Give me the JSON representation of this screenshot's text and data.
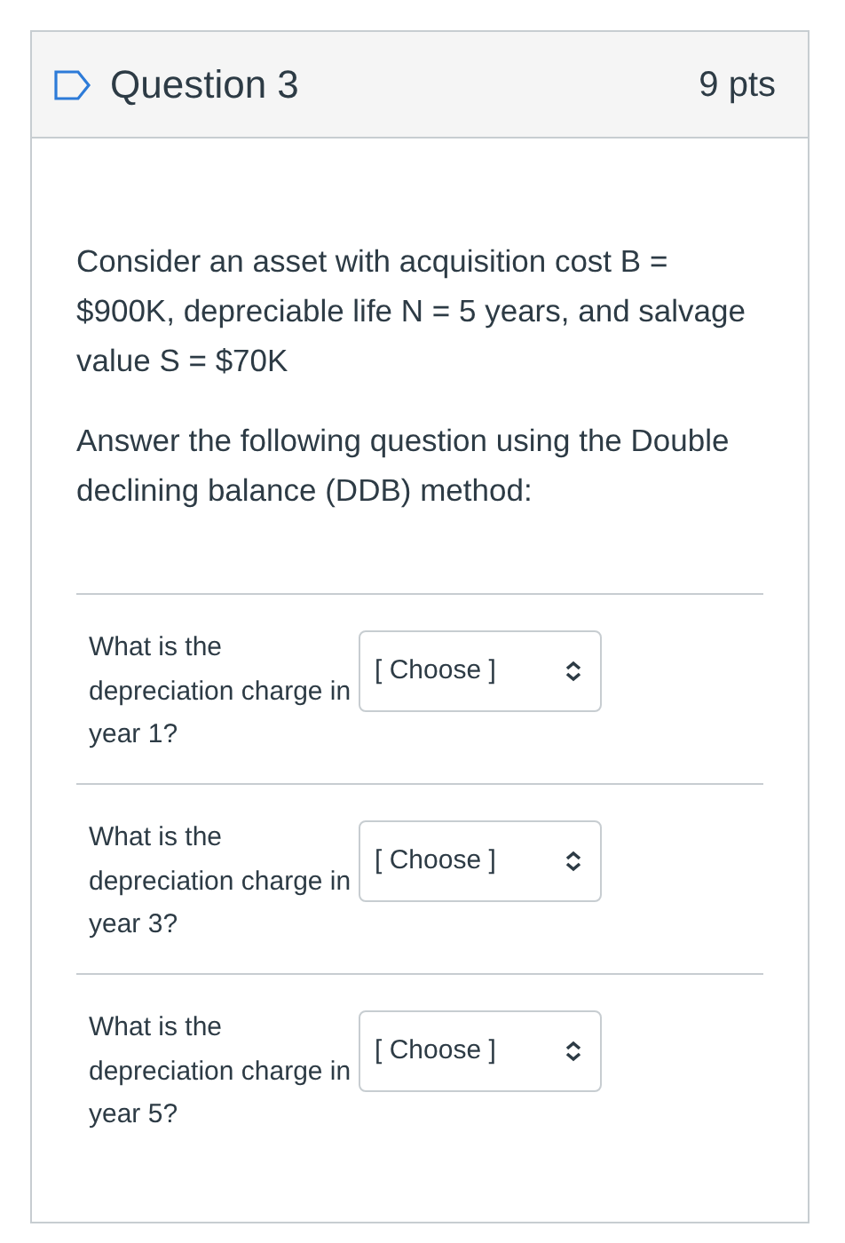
{
  "question": {
    "title": "Question 3",
    "points": "9 pts"
  },
  "paragraphs": [
    "Consider an asset with acquisition cost B = $900K, depreciable life N = 5 years, and salvage value S = $70K",
    "Answer the following question using the Double declining balance (DDB) method:"
  ],
  "rows": [
    {
      "prompt": "What is the depreciation charge in year 1?",
      "value": "[ Choose ]"
    },
    {
      "prompt": "What is the depreciation charge in year 3?",
      "value": "[ Choose ]"
    },
    {
      "prompt": "What is the depreciation charge in year 5?",
      "value": "[ Choose ]"
    }
  ]
}
